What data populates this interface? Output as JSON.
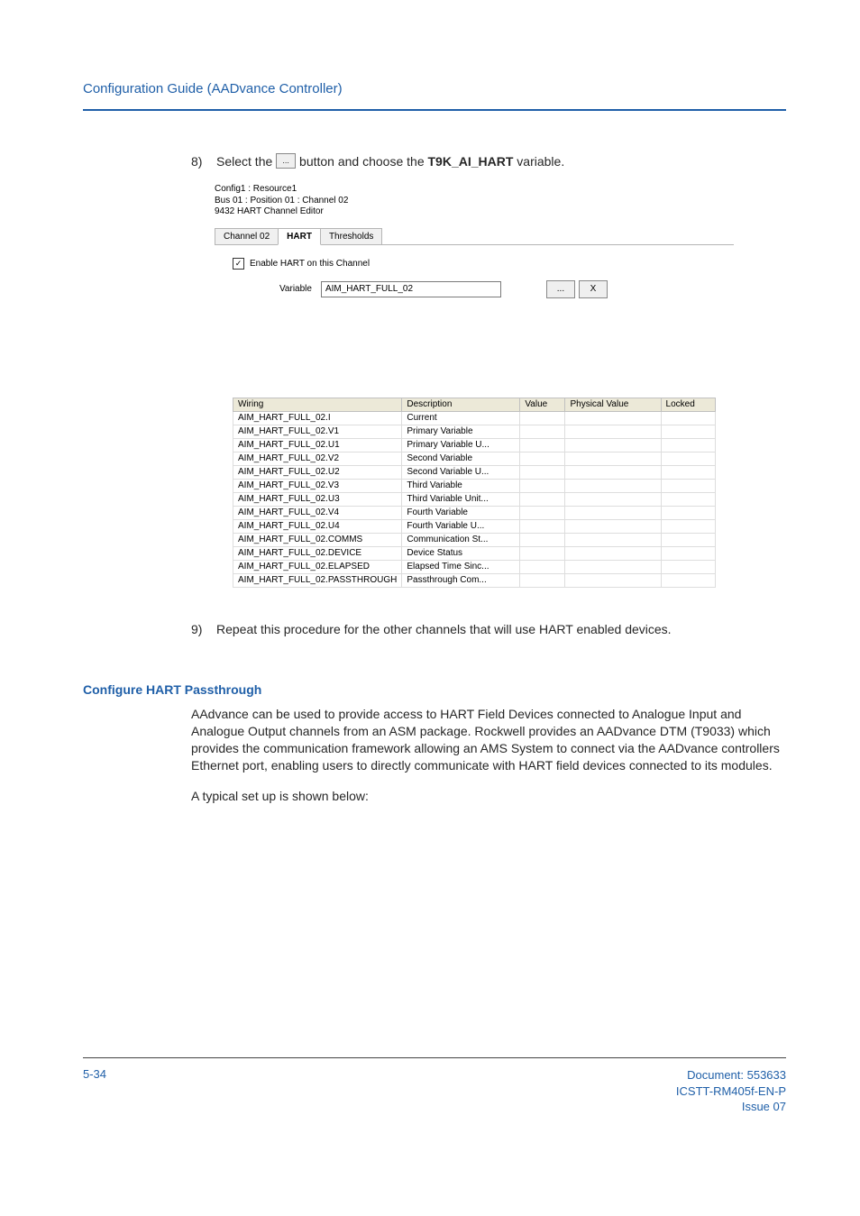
{
  "header_title": "Configuration Guide (AADvance Controller)",
  "steps": {
    "step8": {
      "number": "8)",
      "text_pre": "Select the ",
      "text_mid": " button and choose the ",
      "var_bold": "T9K_AI_HART",
      "text_post": " variable."
    },
    "step9": {
      "number": "9)",
      "text": "Repeat this procedure for the other channels that will use HART enabled devices."
    }
  },
  "screenshot": {
    "title_lines": [
      "Config1 : Resource1",
      "Bus 01 : Position 01 : Channel 02",
      "9432 HART Channel Editor"
    ],
    "tabs": [
      "Channel 02",
      "HART",
      "Thresholds"
    ],
    "checkbox_label": "Enable HART on this Channel",
    "variable_label": "Variable",
    "variable_value": "AIM_HART_FULL_02",
    "ellipsis": "...",
    "clear": "X",
    "columns": [
      "Wiring",
      "Description",
      "Value",
      "Physical Value",
      "Locked"
    ],
    "rows": [
      {
        "w": "AIM_HART_FULL_02.I",
        "d": "Current"
      },
      {
        "w": "AIM_HART_FULL_02.V1",
        "d": "Primary Variable"
      },
      {
        "w": "AIM_HART_FULL_02.U1",
        "d": "Primary Variable U..."
      },
      {
        "w": "AIM_HART_FULL_02.V2",
        "d": "Second Variable"
      },
      {
        "w": "AIM_HART_FULL_02.U2",
        "d": "Second Variable U..."
      },
      {
        "w": "AIM_HART_FULL_02.V3",
        "d": "Third Variable"
      },
      {
        "w": "AIM_HART_FULL_02.U3",
        "d": "Third Variable Unit..."
      },
      {
        "w": "AIM_HART_FULL_02.V4",
        "d": "Fourth Variable"
      },
      {
        "w": "AIM_HART_FULL_02.U4",
        "d": "Fourth Variable U..."
      },
      {
        "w": "AIM_HART_FULL_02.COMMS",
        "d": "Communication St..."
      },
      {
        "w": "AIM_HART_FULL_02.DEVICE",
        "d": "Device Status"
      },
      {
        "w": "AIM_HART_FULL_02.ELAPSED",
        "d": "Elapsed Time Sinc..."
      },
      {
        "w": "AIM_HART_FULL_02.PASSTHROUGH",
        "d": "Passthrough Com..."
      }
    ]
  },
  "section": {
    "heading": "Configure HART Passthrough",
    "p1": "AAdvance can be used to provide access to HART Field Devices connected to Analogue Input and Analogue Output channels from an ASM package. Rockwell provides an AADvance DTM (T9033) which provides the communication framework allowing an AMS System to connect via the AADvance controllers Ethernet port, enabling users to directly communicate with HART field devices connected to its modules.",
    "p2": "A typical set up is shown below:"
  },
  "footer": {
    "page": "5-34",
    "doc": "Document: 553633",
    "code": "ICSTT-RM405f-EN-P",
    "issue": "Issue 07"
  }
}
